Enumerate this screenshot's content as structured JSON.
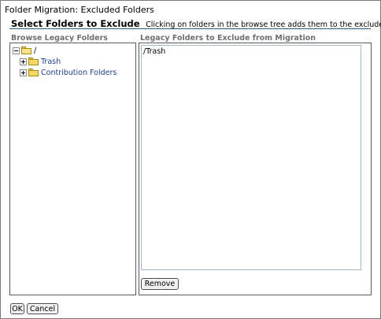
{
  "window": {
    "title": "Folder Migration: Excluded Folders"
  },
  "header": {
    "heading": "Select Folders to Exclude",
    "instructions": "Clicking on folders in the browse tree adds them to the exclude list."
  },
  "browse_panel": {
    "label": "Browse Legacy Folders",
    "tree": {
      "root": {
        "label": "/",
        "icon": "folder-open-icon",
        "expanded": true
      },
      "children": [
        {
          "label": "Trash",
          "icon": "folder-icon",
          "expanded": false
        },
        {
          "label": "Contribution Folders",
          "icon": "folder-icon",
          "expanded": false
        }
      ]
    }
  },
  "exclude_panel": {
    "label": "Legacy Folders to Exclude from Migration",
    "items": [
      "/Trash"
    ],
    "remove_label": "Remove"
  },
  "footer": {
    "ok_label": "OK",
    "cancel_label": "Cancel"
  },
  "colors": {
    "rule": "#2e5f8a",
    "panel_label": "#6f6f6f",
    "tree_link": "#1f3f8f",
    "folder": "#f5d863",
    "list_border": "#9db8d2"
  }
}
